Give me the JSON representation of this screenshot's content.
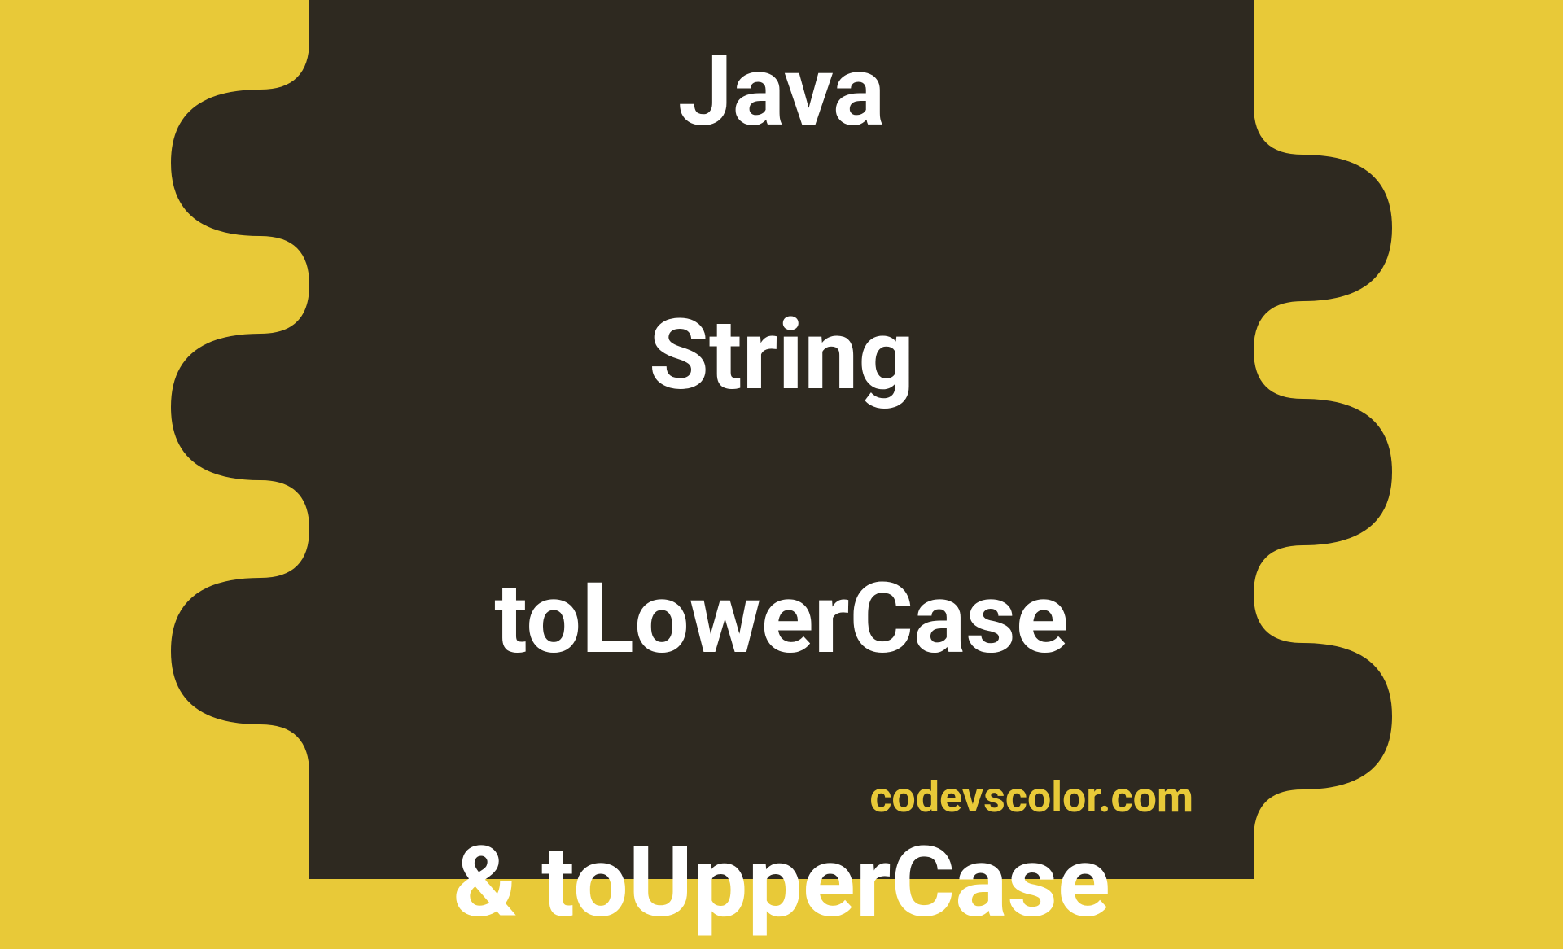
{
  "title": {
    "line1": "Java",
    "line2": "String",
    "line3": "toLowerCase",
    "line4": "& toUpperCase"
  },
  "footer": "codevscolor.com",
  "colors": {
    "background": "#E8C938",
    "blob": "#2E2920",
    "titleText": "#FFFFFF",
    "footerText": "#E8C938"
  }
}
